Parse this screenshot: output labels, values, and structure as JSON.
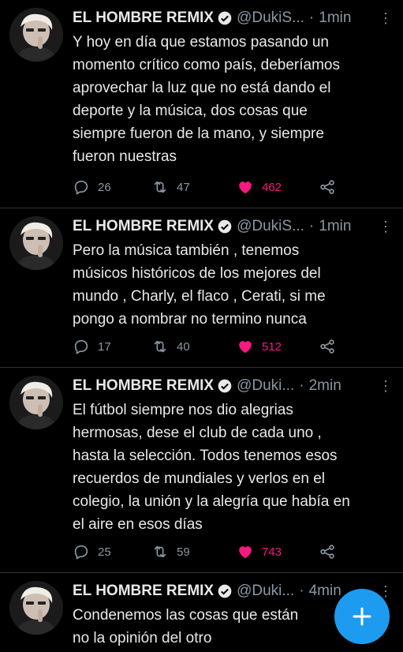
{
  "tweets": [
    {
      "name": "EL HOMBRE REMIX",
      "handle": "@DukiS...",
      "time": "1min",
      "text": "Y hoy en día que estamos pasando un\nmomento crítico como país, deberíamos\naprovechar la luz que no está dando el\ndeporte y la música, dos cosas que\nsiempre fueron de la mano, y siempre\nfueron nuestras",
      "replies": "26",
      "retweets": "47",
      "likes": "462"
    },
    {
      "name": "EL HOMBRE REMIX",
      "handle": "@DukiS...",
      "time": "1min",
      "text": "Pero la música también , tenemos\nmúsicos históricos de los mejores del\nmundo , Charly, el flaco , Cerati, si me\npongo a nombrar no termino nunca",
      "replies": "17",
      "retweets": "40",
      "likes": "512"
    },
    {
      "name": "EL HOMBRE REMIX",
      "handle": "@Duki...",
      "time": "2min",
      "text": "El fútbol siempre nos dio alegrias\nhermosas, dese el club de cada uno ,\nhasta la selección. Todos tenemos esos\nrecuerdos de mundiales y verlos en el\ncolegio, la unión y la alegría que había en\nel aire en esos días",
      "replies": "25",
      "retweets": "59",
      "likes": "743"
    },
    {
      "name": "EL HOMBRE REMIX",
      "handle": "@Duki...",
      "time": "4min",
      "text": "Condenemos las cosas que están\nno la opinión del otro"
    }
  ],
  "colors": {
    "background": "#000000",
    "text": "#e7e9ea",
    "muted": "#8b98a5",
    "like": "#f91880",
    "accent": "#1d9bf0",
    "divider": "#2f3336"
  },
  "icons": {
    "reply": "reply-icon",
    "retweet": "retweet-icon",
    "like": "heart-icon",
    "share": "share-icon",
    "verified": "verified-badge-icon",
    "more": "more-options-icon",
    "compose": "plus-icon"
  }
}
